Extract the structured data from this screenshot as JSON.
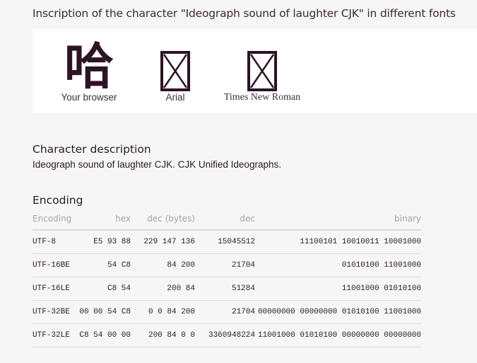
{
  "header": {
    "title": "Inscription of the character \"Ideograph sound of laughter CJK\" in different fonts"
  },
  "fonts_panel": {
    "glyph": "哈",
    "samples": [
      {
        "caption": "Your browser"
      },
      {
        "caption": "Arial"
      },
      {
        "caption": "Times New Roman"
      }
    ]
  },
  "description": {
    "heading": "Character description",
    "text": "Ideograph sound of laughter CJK. CJK Unified Ideographs."
  },
  "encoding": {
    "heading": "Encoding",
    "columns": [
      "Encoding",
      "hex",
      "dec (bytes)",
      "dec",
      "binary"
    ],
    "rows": [
      [
        "UTF-8",
        "E5 93 88",
        "229 147 136",
        "15045512",
        "11100101 10010011 10001000"
      ],
      [
        "UTF-16BE",
        "54 C8",
        "84 200",
        "21704",
        "01010100 11001000"
      ],
      [
        "UTF-16LE",
        "C8 54",
        "200 84",
        "51284",
        "11001000 01010100"
      ],
      [
        "UTF-32BE",
        "00 00 54 C8",
        "0 0 84 200",
        "21704",
        "00000000 00000000 01010100 11001000"
      ],
      [
        "UTF-32LE",
        "C8 54 00 00",
        "200 84 0 0",
        "3360948224",
        "11001000 01010100 00000000 00000000"
      ]
    ]
  },
  "colors": {
    "glyph": "#2d1326",
    "panel_bg": "#ffffff",
    "page_bg": "#f6f6f6"
  }
}
